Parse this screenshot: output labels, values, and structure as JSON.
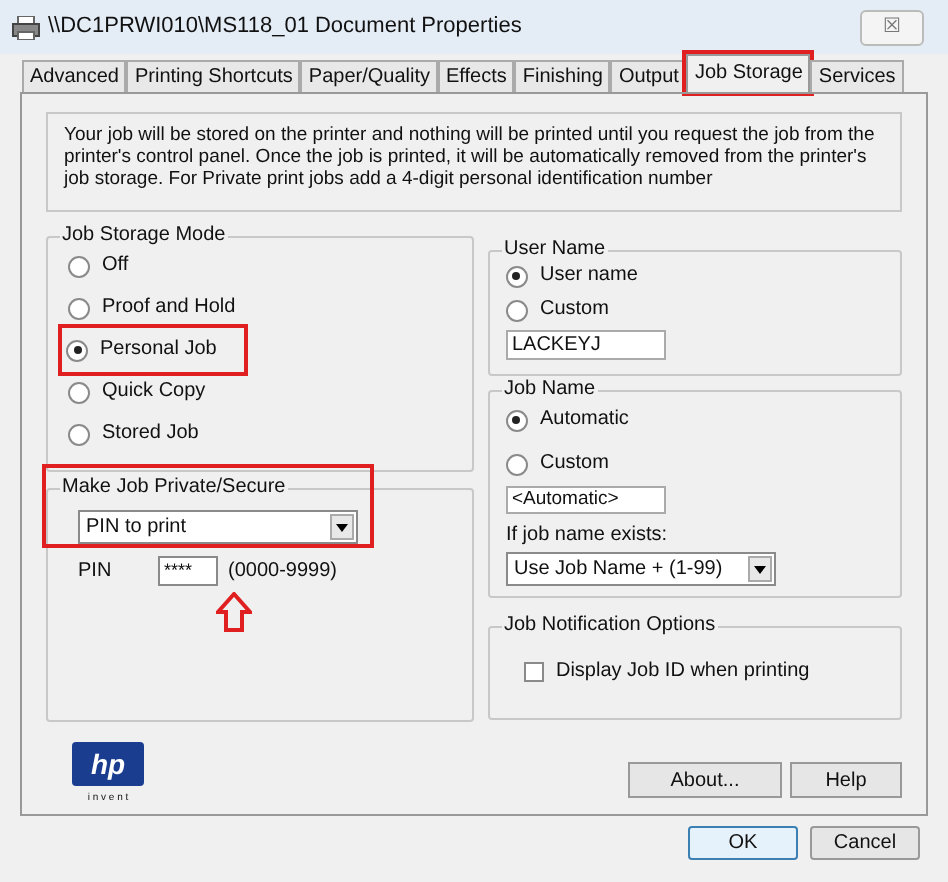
{
  "window": {
    "title": "\\\\DC1PRWI010\\MS118_01 Document Properties",
    "close": "☒"
  },
  "tabs": [
    {
      "label": "Advanced",
      "selected": false,
      "highlighted": false
    },
    {
      "label": "Printing Shortcuts",
      "selected": false,
      "highlighted": false
    },
    {
      "label": "Paper/Quality",
      "selected": false,
      "highlighted": false
    },
    {
      "label": "Effects",
      "selected": false,
      "highlighted": false
    },
    {
      "label": "Finishing",
      "selected": false,
      "highlighted": false
    },
    {
      "label": "Output",
      "selected": false,
      "highlighted": false
    },
    {
      "label": "Job Storage",
      "selected": true,
      "highlighted": true
    },
    {
      "label": "Services",
      "selected": false,
      "highlighted": false
    }
  ],
  "description": "Your job will be stored on the printer and nothing will be printed until you request the job from the printer's control panel.  Once the job is printed, it will be automatically removed from the printer's job storage.  For Private print jobs add a 4-digit personal identification number",
  "job_storage_mode": {
    "title": "Job Storage Mode",
    "options": [
      {
        "label": "Off",
        "selected": false,
        "highlighted": false
      },
      {
        "label": "Proof and Hold",
        "selected": false,
        "highlighted": false
      },
      {
        "label": "Personal Job",
        "selected": true,
        "highlighted": true
      },
      {
        "label": "Quick Copy",
        "selected": false,
        "highlighted": false
      },
      {
        "label": "Stored Job",
        "selected": false,
        "highlighted": false
      }
    ]
  },
  "make_private": {
    "title": "Make Job Private/Secure",
    "highlighted": true,
    "dropdown": "PIN to print",
    "pin_label": "PIN",
    "pin_value": "****",
    "pin_range": "(0000-9999)"
  },
  "user_name": {
    "title": "User Name",
    "options": [
      {
        "label": "User name",
        "selected": true
      },
      {
        "label": "Custom",
        "selected": false
      }
    ],
    "value": "LACKEYJ"
  },
  "job_name": {
    "title": "Job Name",
    "options": [
      {
        "label": "Automatic",
        "selected": true
      },
      {
        "label": "Custom",
        "selected": false
      }
    ],
    "value": "<Automatic>",
    "exists_label": "If job name exists:",
    "exists_dropdown": "Use Job Name + (1-99)"
  },
  "notification": {
    "title": "Job Notification Options",
    "checkbox": {
      "label": "Display Job ID when printing",
      "checked": false
    }
  },
  "logo": {
    "mark": "hp",
    "tagline": "i n v e n t"
  },
  "buttons": [
    "About...",
    "Help"
  ],
  "dialog_buttons": [
    "OK",
    "Cancel"
  ]
}
